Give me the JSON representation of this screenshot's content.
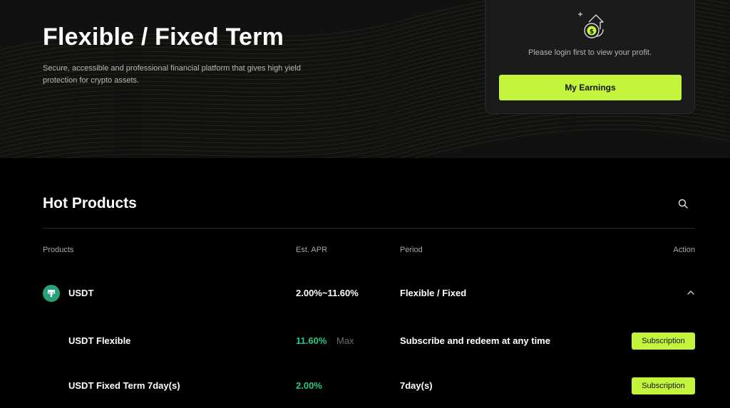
{
  "hero": {
    "title": "Flexible / Fixed Term",
    "description": "Secure, accessible and professional financial platform that gives high yield protection for crypto assets."
  },
  "earnings_card": {
    "message": "Please login first to view your profit.",
    "button_label": "My Earnings",
    "icon": "money-bag-growth-icon"
  },
  "hot_products": {
    "title": "Hot Products",
    "search_icon": "search-icon",
    "columns": {
      "products": "Products",
      "apr": "Est. APR",
      "period": "Period",
      "action": "Action"
    },
    "group": {
      "coin": "USDT",
      "apr": "2.00%~11.60%",
      "period": "Flexible / Fixed",
      "coin_color": "#26a17b",
      "expand_icon": "chevron-up-icon"
    },
    "items": [
      {
        "name": "USDT Flexible",
        "apr": "11.60%",
        "apr_suffix": "Max",
        "period": "Subscribe and redeem at any time",
        "action": "Subscription"
      },
      {
        "name": "USDT Fixed Term 7day(s)",
        "apr": "2.00%",
        "period": "7day(s)",
        "action": "Subscription"
      }
    ]
  },
  "colors": {
    "accent": "#c3f53c",
    "positive": "#27c886",
    "background": "#000000",
    "hero_background": "#111111"
  }
}
